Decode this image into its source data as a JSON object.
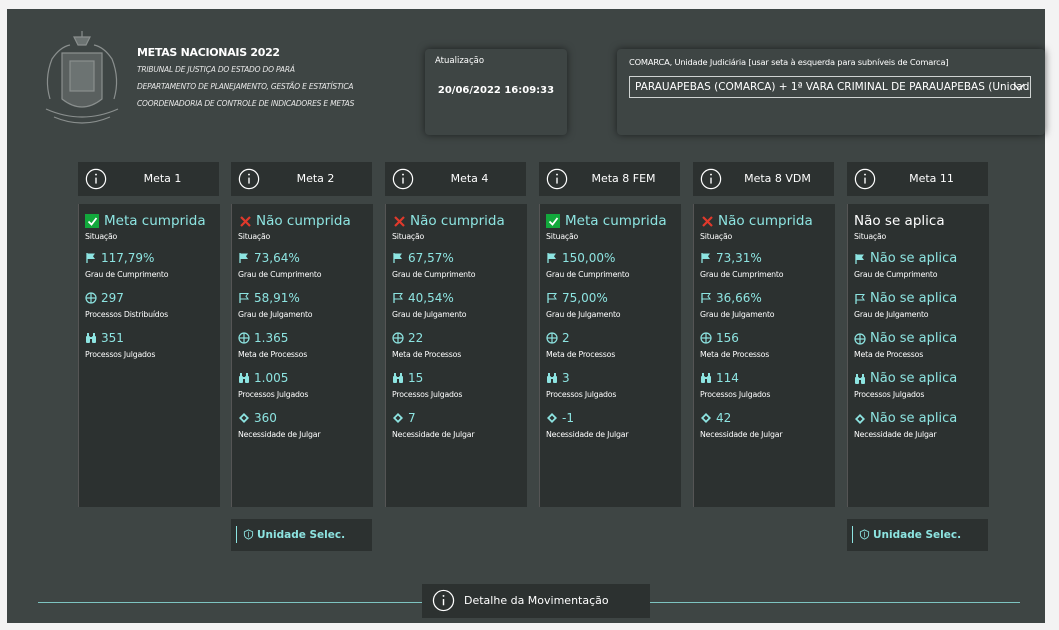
{
  "header": {
    "title": "METAS NACIONAIS 2022",
    "lines": [
      "TRIBUNAL DE JUSTIÇA DO ESTADO DO PARÁ",
      "DEPARTAMENTO DE PLANEJAMENTO, GESTÃO E ESTATÍSTICA",
      "COORDENADORIA DE CONTROLE DE INDICADORES E METAS"
    ]
  },
  "update": {
    "label": "Atualização",
    "value": "20/06/2022 16:09:33"
  },
  "comarca": {
    "label": "COMARCA, Unidade Judiciária [usar seta à esquerda para subníveis de Comarca]",
    "selected": "PARAUAPEBAS (COMARCA) + 1ª VARA CRIMINAL DE PARAUAPEBAS (Unidade ..."
  },
  "labels": {
    "situacao": "Situação",
    "grau_cumprimento": "Grau de Cumprimento",
    "grau_julgamento": "Grau de Julgamento",
    "processos_distribuidos": "Processos Distribuídos",
    "processos_julgados": "Processos Julgados",
    "meta_processos": "Meta de Processos",
    "necessidade": "Necessidade de Julgar"
  },
  "metas": [
    {
      "name": "Meta 1",
      "status": "Meta cumprida",
      "status_type": "ok",
      "grau_cumprimento": "117,79%",
      "processos_distribuidos": "297",
      "processos_julgados": "351"
    },
    {
      "name": "Meta 2",
      "status": "Não cumprida",
      "status_type": "fail",
      "grau_cumprimento": "73,64%",
      "grau_julgamento": "58,91%",
      "meta_processos": "1.365",
      "processos_julgados": "1.005",
      "necessidade": "360"
    },
    {
      "name": "Meta 4",
      "status": "Não cumprida",
      "status_type": "fail",
      "grau_cumprimento": "67,57%",
      "grau_julgamento": "40,54%",
      "meta_processos": "22",
      "processos_julgados": "15",
      "necessidade": "7"
    },
    {
      "name": "Meta 8 FEM",
      "status": "Meta cumprida",
      "status_type": "ok",
      "grau_cumprimento": "150,00%",
      "grau_julgamento": "75,00%",
      "meta_processos": "2",
      "processos_julgados": "3",
      "necessidade": "-1"
    },
    {
      "name": "Meta 8 VDM",
      "status": "Não cumprida",
      "status_type": "fail",
      "grau_cumprimento": "73,31%",
      "grau_julgamento": "36,66%",
      "meta_processos": "156",
      "processos_julgados": "114",
      "necessidade": "42"
    },
    {
      "name": "Meta 11",
      "status": "Não se aplica",
      "status_type": "na",
      "grau_cumprimento": "Não se aplica",
      "grau_julgamento": "Não se aplica",
      "meta_processos": "Não se aplica",
      "processos_julgados": "Não se aplica",
      "necessidade": "Não se aplica"
    }
  ],
  "unit_button": {
    "label": "Unidade Selec."
  },
  "detail_button": {
    "label": "Detalhe da Movimentação"
  },
  "colors": {
    "accent": "#8de4e1",
    "panel": "#2c3130",
    "background": "#3e4544",
    "ok": "#12a83c",
    "fail": "#e0392b"
  },
  "icons": {
    "info": "info-circle-icon",
    "ok": "checkbox-check-icon",
    "fail": "x-icon",
    "grau_cumprimento": "flag-filled-icon",
    "grau_julgamento": "flag-outline-icon",
    "meta_processos": "crosshair-icon",
    "processos_julgados": "binoculars-icon",
    "necessidade": "diamond-icon",
    "unit": "shield-icon"
  }
}
